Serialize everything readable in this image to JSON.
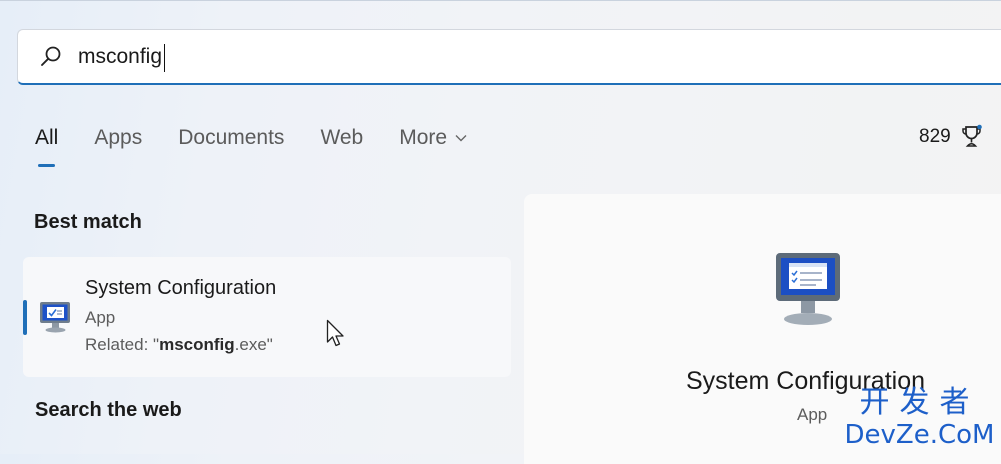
{
  "search": {
    "query": "msconfig"
  },
  "tabs": [
    {
      "label": "All",
      "active": true
    },
    {
      "label": "Apps"
    },
    {
      "label": "Documents"
    },
    {
      "label": "Web"
    },
    {
      "label": "More"
    }
  ],
  "rewards": {
    "points": "829",
    "icon": "trophy-icon"
  },
  "best_match": {
    "heading": "Best match",
    "result": {
      "title": "System Configuration",
      "type": "App",
      "related_prefix": "Related: \"",
      "related_bold": "msconfig",
      "related_suffix": ".exe\"",
      "icon": "system-configuration-icon"
    }
  },
  "web_section": {
    "heading": "Search the web"
  },
  "preview": {
    "title": "System Configuration",
    "type": "App",
    "icon": "system-configuration-icon"
  },
  "watermark": {
    "line1": "开发者",
    "line2": "DevZe.CoM"
  },
  "colors": {
    "accent": "#1f6fb8",
    "watermark": "#1d5fc9"
  }
}
